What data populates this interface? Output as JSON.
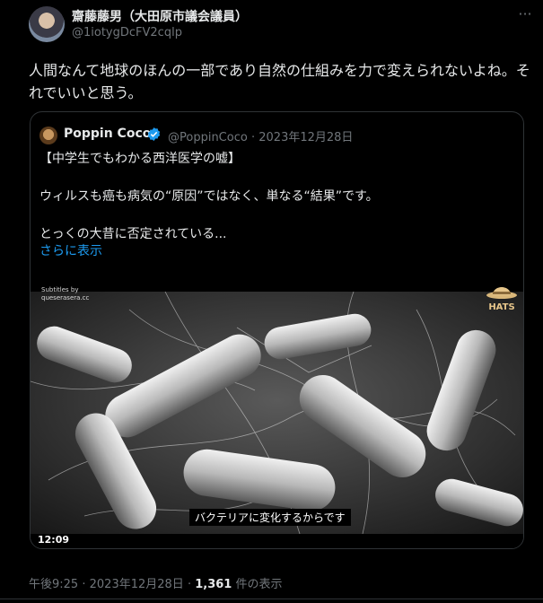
{
  "author": {
    "name": "齋藤藤男（大田原市議会議員）",
    "handle": "@1iotygDcFV2cqlp"
  },
  "tweet": {
    "text": "人間なんて地球のほんの一部であり自然の仕組みを力で変えられないよね。それでいいと思う。"
  },
  "quoted": {
    "name": "Poppin Coco",
    "handle": "@PoppinCoco",
    "date": "2023年12月28日",
    "lines": [
      "【中学生でもわかる西洋医学の嘘】",
      "",
      "ウィルスも癌も病気の“原因”ではなく、単なる“結果”です。",
      "",
      "とっくの大昔に否定されている..."
    ],
    "show_more": "さらに表示",
    "video": {
      "subtitles_by": "Subtitles by",
      "subtitles_site": "queserasera.cc",
      "logo": "HATS",
      "caption": "バクテリアに変化するからです",
      "duration": "12:09"
    }
  },
  "footer": {
    "time": "午後9:25",
    "date": "2023年12月28日",
    "views_count": "1,361",
    "views_label": "件の表示",
    "separator": "·"
  },
  "colors": {
    "background": "#000000",
    "text": "#e7e9ea",
    "muted": "#71767b",
    "link": "#1d9bf0",
    "border": "#2f3336",
    "verified": "#1d9bf0"
  }
}
